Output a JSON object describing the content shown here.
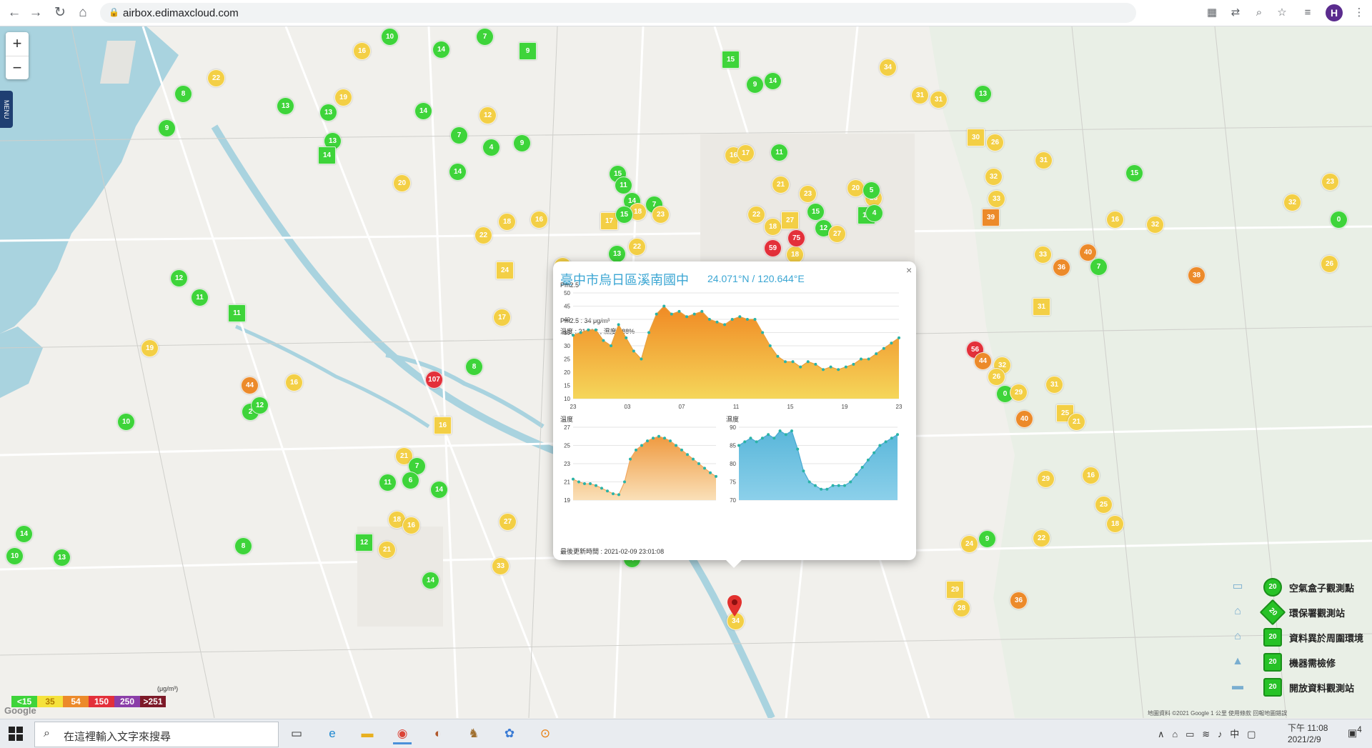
{
  "browser": {
    "url": "airbox.edimaxcloud.com",
    "profile_initial": "H"
  },
  "map": {
    "zoom_in": "+",
    "zoom_out": "−",
    "menu_label": "MENU",
    "google_logo": "Google",
    "attribution": "地圖資料 ©2021 Google   1 公里   使用條款   回報地圖錯誤",
    "pin_value": "34",
    "markers": [
      {
        "v": "16",
        "c": "yellow"
      },
      {
        "v": "10",
        "c": "green"
      },
      {
        "v": "14",
        "c": "green"
      },
      {
        "v": "7",
        "c": "green"
      },
      {
        "v": "9",
        "c": "green"
      },
      {
        "v": "8",
        "c": "green"
      },
      {
        "v": "22",
        "c": "yellow"
      },
      {
        "v": "9",
        "c": "green"
      },
      {
        "v": "19",
        "c": "yellow"
      },
      {
        "v": "13",
        "c": "green"
      },
      {
        "v": "13",
        "c": "green"
      },
      {
        "v": "14",
        "c": "green"
      },
      {
        "v": "13",
        "c": "green"
      },
      {
        "v": "14",
        "c": "green"
      },
      {
        "v": "4",
        "c": "green"
      },
      {
        "v": "7",
        "c": "green"
      },
      {
        "v": "14",
        "c": "green"
      },
      {
        "v": "9",
        "c": "green"
      },
      {
        "v": "12",
        "c": "yellow"
      },
      {
        "v": "20",
        "c": "yellow"
      },
      {
        "v": "18",
        "c": "yellow"
      },
      {
        "v": "16",
        "c": "yellow"
      },
      {
        "v": "17",
        "c": "yellow"
      },
      {
        "v": "15",
        "c": "green"
      },
      {
        "v": "11",
        "c": "green"
      },
      {
        "v": "14",
        "c": "green"
      },
      {
        "v": "13",
        "c": "green"
      },
      {
        "v": "7",
        "c": "green"
      },
      {
        "v": "22",
        "c": "yellow"
      },
      {
        "v": "18",
        "c": "yellow"
      },
      {
        "v": "22",
        "c": "yellow"
      },
      {
        "v": "24",
        "c": "yellow"
      },
      {
        "v": "17",
        "c": "yellow"
      },
      {
        "v": "15",
        "c": "green"
      },
      {
        "v": "23",
        "c": "yellow"
      },
      {
        "v": "25",
        "c": "yellow"
      },
      {
        "v": "16",
        "c": "yellow"
      },
      {
        "v": "18",
        "c": "yellow"
      },
      {
        "v": "12",
        "c": "green"
      },
      {
        "v": "11",
        "c": "green"
      },
      {
        "v": "11",
        "c": "green"
      },
      {
        "v": "19",
        "c": "yellow"
      },
      {
        "v": "44",
        "c": "orange"
      },
      {
        "v": "16",
        "c": "yellow"
      },
      {
        "v": "107",
        "c": "red"
      },
      {
        "v": "8",
        "c": "green"
      },
      {
        "v": "2",
        "c": "green"
      },
      {
        "v": "12",
        "c": "green"
      },
      {
        "v": "10",
        "c": "green"
      },
      {
        "v": "16",
        "c": "yellow"
      },
      {
        "v": "21",
        "c": "yellow"
      },
      {
        "v": "7",
        "c": "green"
      },
      {
        "v": "11",
        "c": "green"
      },
      {
        "v": "6",
        "c": "green"
      },
      {
        "v": "14",
        "c": "green"
      },
      {
        "v": "18",
        "c": "yellow"
      },
      {
        "v": "16",
        "c": "yellow"
      },
      {
        "v": "27",
        "c": "yellow"
      },
      {
        "v": "12",
        "c": "green"
      },
      {
        "v": "21",
        "c": "yellow"
      },
      {
        "v": "14",
        "c": "green"
      },
      {
        "v": "8",
        "c": "green"
      },
      {
        "v": "13",
        "c": "green"
      },
      {
        "v": "10",
        "c": "green"
      },
      {
        "v": "33",
        "c": "yellow"
      },
      {
        "v": "14",
        "c": "green"
      },
      {
        "v": "4",
        "c": "green"
      },
      {
        "v": "15",
        "c": "green"
      },
      {
        "v": "14",
        "c": "green"
      },
      {
        "v": "9",
        "c": "green"
      },
      {
        "v": "16",
        "c": "yellow"
      },
      {
        "v": "21",
        "c": "yellow"
      },
      {
        "v": "17",
        "c": "yellow"
      },
      {
        "v": "11",
        "c": "green"
      },
      {
        "v": "22",
        "c": "yellow"
      },
      {
        "v": "18",
        "c": "yellow"
      },
      {
        "v": "27",
        "c": "yellow"
      },
      {
        "v": "23",
        "c": "yellow"
      },
      {
        "v": "59",
        "c": "red"
      },
      {
        "v": "18",
        "c": "yellow"
      },
      {
        "v": "75",
        "c": "red"
      },
      {
        "v": "15",
        "c": "green"
      },
      {
        "v": "12",
        "c": "green"
      },
      {
        "v": "20",
        "c": "yellow"
      },
      {
        "v": "25",
        "c": "yellow"
      },
      {
        "v": "13",
        "c": "green"
      },
      {
        "v": "5",
        "c": "green"
      },
      {
        "v": "4",
        "c": "green"
      },
      {
        "v": "0",
        "c": "green"
      },
      {
        "v": "27",
        "c": "yellow"
      },
      {
        "v": "34",
        "c": "yellow"
      },
      {
        "v": "31",
        "c": "yellow"
      },
      {
        "v": "31",
        "c": "yellow"
      },
      {
        "v": "13",
        "c": "green"
      },
      {
        "v": "30",
        "c": "yellow"
      },
      {
        "v": "26",
        "c": "yellow"
      },
      {
        "v": "32",
        "c": "yellow"
      },
      {
        "v": "31",
        "c": "yellow"
      },
      {
        "v": "15",
        "c": "green"
      },
      {
        "v": "32",
        "c": "yellow"
      },
      {
        "v": "0",
        "c": "green"
      },
      {
        "v": "26",
        "c": "yellow"
      },
      {
        "v": "23",
        "c": "yellow"
      },
      {
        "v": "39",
        "c": "orange"
      },
      {
        "v": "33",
        "c": "yellow"
      },
      {
        "v": "16",
        "c": "yellow"
      },
      {
        "v": "32",
        "c": "yellow"
      },
      {
        "v": "38",
        "c": "orange"
      },
      {
        "v": "33",
        "c": "yellow"
      },
      {
        "v": "40",
        "c": "orange"
      },
      {
        "v": "7",
        "c": "green"
      },
      {
        "v": "36",
        "c": "orange"
      },
      {
        "v": "31",
        "c": "yellow"
      },
      {
        "v": "56",
        "c": "red"
      },
      {
        "v": "44",
        "c": "orange"
      },
      {
        "v": "32",
        "c": "yellow"
      },
      {
        "v": "26",
        "c": "yellow"
      },
      {
        "v": "0",
        "c": "green"
      },
      {
        "v": "29",
        "c": "yellow"
      },
      {
        "v": "40",
        "c": "orange"
      },
      {
        "v": "31",
        "c": "yellow"
      },
      {
        "v": "25",
        "c": "yellow"
      },
      {
        "v": "21",
        "c": "yellow"
      },
      {
        "v": "29",
        "c": "yellow"
      },
      {
        "v": "16",
        "c": "yellow"
      },
      {
        "v": "25",
        "c": "yellow"
      },
      {
        "v": "18",
        "c": "yellow"
      },
      {
        "v": "22",
        "c": "yellow"
      },
      {
        "v": "9",
        "c": "green"
      },
      {
        "v": "24",
        "c": "yellow"
      },
      {
        "v": "29",
        "c": "yellow"
      },
      {
        "v": "28",
        "c": "yellow"
      },
      {
        "v": "36",
        "c": "orange"
      }
    ]
  },
  "popup": {
    "title": "臺中市烏日區溪南國中",
    "coords": "24.071°N / 120.644°E",
    "close": "×",
    "pm_line": "Pm2.5 : 34 μg/m³",
    "temp_hum_line": "溫度 : 21.6°C , 濕度 : 88%",
    "updated": "最後更新時間 : 2021-02-09 23:01:08"
  },
  "chart_data": [
    {
      "type": "area",
      "title": "Pm2.5",
      "x": [
        "23",
        "",
        "",
        "",
        "03",
        "",
        "",
        "",
        "07",
        "",
        "",
        "",
        "11",
        "",
        "",
        "",
        "15",
        "",
        "",
        "",
        "19",
        "",
        "",
        "",
        "23"
      ],
      "tick_labels": [
        "23",
        "03",
        "07",
        "11",
        "15",
        "19",
        "23"
      ],
      "series": [
        {
          "values": [
            34,
            35,
            36,
            36,
            32,
            30,
            38,
            33,
            28,
            25,
            35,
            42,
            45,
            42,
            43,
            41,
            42,
            43,
            40,
            39,
            38,
            40,
            41,
            40,
            40,
            35,
            30,
            26,
            24,
            24,
            22,
            24,
            23,
            21,
            22,
            21,
            22,
            23,
            25,
            25,
            27,
            29,
            31,
            33
          ]
        }
      ],
      "ylim": [
        10,
        50
      ],
      "yticks": [
        10,
        15,
        20,
        25,
        30,
        35,
        40,
        45,
        50
      ]
    },
    {
      "type": "area",
      "title": "溫度",
      "series": [
        {
          "values": [
            21.3,
            21,
            20.8,
            20.8,
            20.6,
            20.3,
            20,
            19.7,
            19.6,
            21,
            23.5,
            24.5,
            25,
            25.5,
            25.8,
            26,
            25.8,
            25.5,
            25,
            24.5,
            24,
            23.5,
            23,
            22.5,
            22,
            21.6
          ]
        }
      ],
      "ylim": [
        19,
        27
      ],
      "yticks": [
        19,
        21,
        23,
        25,
        27
      ]
    },
    {
      "type": "area",
      "title": "濕度",
      "series": [
        {
          "values": [
            85,
            86,
            87,
            86,
            87,
            88,
            87,
            89,
            88,
            89,
            84,
            78,
            75,
            74,
            73,
            73,
            74,
            74,
            74,
            75,
            77,
            79,
            81,
            83,
            85,
            86,
            87,
            88
          ]
        }
      ],
      "ylim": [
        70,
        90
      ],
      "yticks": [
        70,
        75,
        80,
        85,
        90
      ]
    }
  ],
  "legend": {
    "scale": [
      {
        "label": "<15",
        "bg": "#3ed43a",
        "fg": "#ffffff"
      },
      {
        "label": "35",
        "bg": "#f5e23c",
        "fg": "#b07a00"
      },
      {
        "label": "54",
        "bg": "#ec8a2a",
        "fg": "#ffffff"
      },
      {
        "label": "150",
        "bg": "#e3303a",
        "fg": "#ffffff"
      },
      {
        "label": "250",
        "bg": "#8b3ea8",
        "fg": "#ffffff"
      },
      {
        "label": ">251",
        "bg": "#7d1a28",
        "fg": "#ffffff"
      }
    ],
    "scale_unit": "(μg/m³)",
    "items": [
      {
        "label": "空氣盒子觀測點",
        "value": "20",
        "icon": "airbox-icon"
      },
      {
        "label": "環保署觀測站",
        "value": "20",
        "icon": "epa-station-icon"
      },
      {
        "label": "資料異於周圍環境",
        "value": "20",
        "icon": "anomaly-icon"
      },
      {
        "label": "機器需檢修",
        "value": "20",
        "icon": "maintenance-icon"
      },
      {
        "label": "開放資料觀測站",
        "value": "20",
        "icon": "open-data-icon"
      }
    ]
  },
  "taskbar": {
    "search_placeholder": "在這裡輸入文字來搜尋",
    "ime": "中",
    "time": "下午 11:08",
    "date": "2021/2/9",
    "notification_count": "4"
  }
}
